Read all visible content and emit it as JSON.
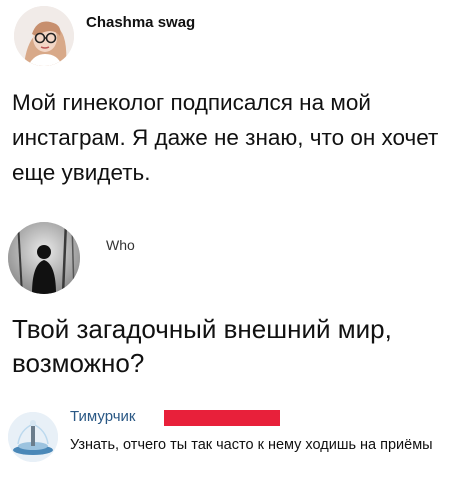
{
  "post1": {
    "author": "Chashma swag",
    "text": "Мой гинеколог подписался на мой инстаграм. Я даже не знаю, что он хочет еще увидеть."
  },
  "post2": {
    "author": "Who",
    "text": "Твой загадочный внешний мир, возможно?"
  },
  "comment": {
    "author": "Тимурчик",
    "text": "Узнать, отчего ты так часто к нему ходишь на приёмы"
  },
  "colors": {
    "redaction": "#e8203a",
    "commenter_name": "#2a5885"
  }
}
